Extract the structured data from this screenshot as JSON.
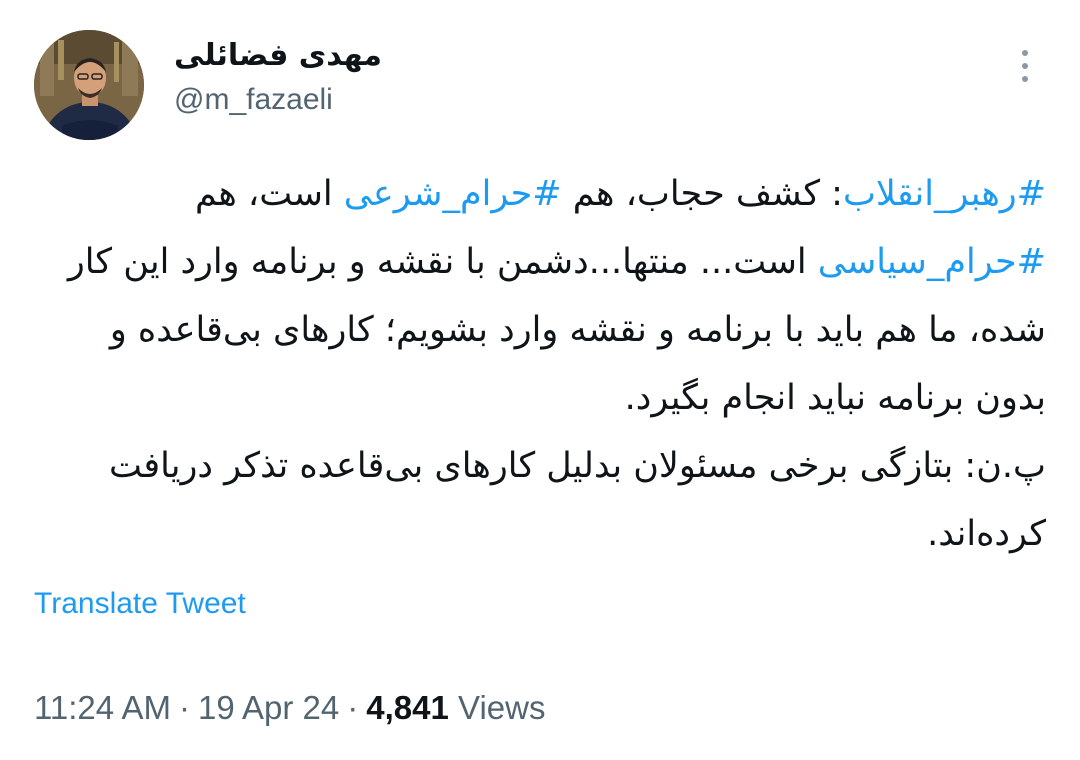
{
  "author": {
    "display_name": "مهدی فضائلی",
    "handle": "@m_fazaeli",
    "avatar_icon": "person-avatar-icon"
  },
  "menu": {
    "icon": "more-vertical-icon"
  },
  "tweet": {
    "paragraph1": {
      "hashtag1": "#رهبر_انقلاب",
      "text1": ": کشف حجاب، هم ",
      "hashtag2": "#حرام_شرعی",
      "text2": " است، هم ",
      "hashtag3": "#حرام_سیاسی",
      "text3": " است... منتها...دشمن با نقشه و برنامه وارد این کار شده، ما هم باید با برنامه و نقشه وارد بشویم؛ کارهای بی‌قاعده و بدون برنامه نباید انجام بگیرد."
    },
    "paragraph2": "پ.ن: بتازگی برخی مسئولان بدلیل کارهای بی‌قاعده تذکر دریافت کرده‌اند."
  },
  "translate_label": "Translate Tweet",
  "meta": {
    "time": "11:24 AM",
    "date": "19 Apr 24",
    "views_count": "4,841",
    "views_label": "Views",
    "separator": "·"
  },
  "colors": {
    "link": "#1d9bf0",
    "text": "#0f1419",
    "secondary": "#536471"
  }
}
